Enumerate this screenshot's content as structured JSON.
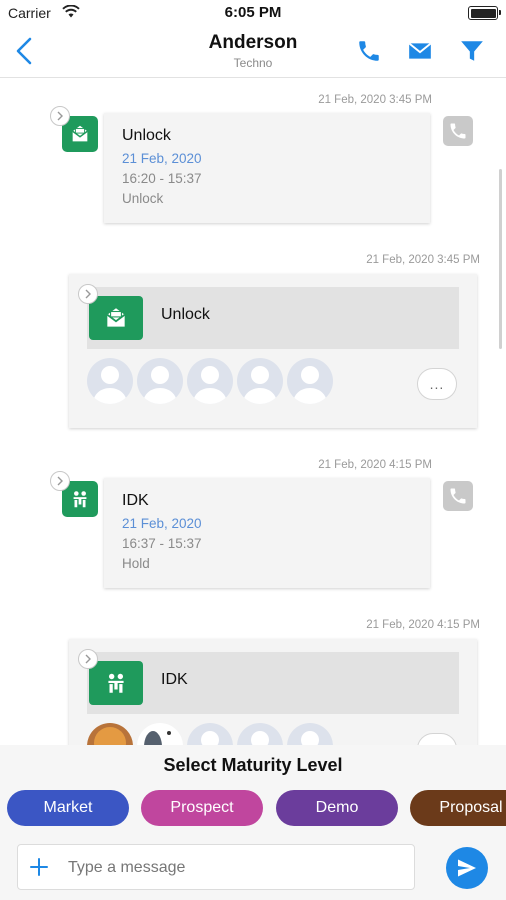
{
  "status_bar": {
    "carrier": "Carrier",
    "time": "6:05 PM"
  },
  "header": {
    "title": "Anderson",
    "subtitle": "Techno"
  },
  "feed": {
    "items": [
      {
        "timestamp": "21 Feb, 2020 3:45 PM",
        "title": "Unlock",
        "date": "21 Feb, 2020",
        "time_range": "16:20 - 15:37",
        "status": "Unlock"
      },
      {
        "timestamp": "21 Feb, 2020 3:45 PM",
        "title": "Unlock",
        "more": "..."
      },
      {
        "timestamp": "21 Feb, 2020 4:15 PM",
        "title": "IDK",
        "date": "21 Feb, 2020",
        "time_range": "16:37 - 15:37",
        "status": "Hold"
      },
      {
        "timestamp": "21 Feb, 2020 4:15 PM",
        "title": "IDK"
      }
    ]
  },
  "maturity": {
    "title": "Select Maturity Level",
    "levels": [
      {
        "label": "Market",
        "color": "#3b56c4"
      },
      {
        "label": "Prospect",
        "color": "#c0469e"
      },
      {
        "label": "Demo",
        "color": "#6b3d9c"
      },
      {
        "label": "Proposal",
        "color": "#6b3a1a"
      }
    ]
  },
  "composer": {
    "placeholder": "Type a message"
  },
  "colors": {
    "accent": "#1e88e5",
    "icon_green": "#1f9a5c",
    "link_date": "#5b8fd6"
  }
}
